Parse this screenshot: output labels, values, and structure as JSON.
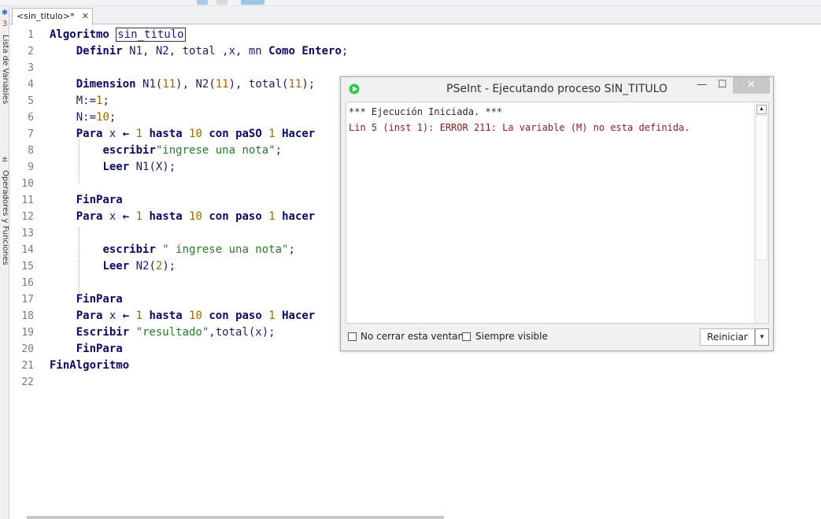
{
  "tab": {
    "label": "<sin_titulo>*",
    "close": "✕"
  },
  "side_panel": {
    "label_vars": "Lista de Variables",
    "label_ops": "Operadores y Funciones"
  },
  "editor": {
    "line_numbers": [
      "1",
      "2",
      "3",
      "4",
      "5",
      "6",
      "7",
      "8",
      "9",
      "10",
      "11",
      "12",
      "13",
      "14",
      "15",
      "16",
      "17",
      "18",
      "19",
      "20",
      "21",
      "22"
    ],
    "lines": [
      [
        {
          "t": "Algoritmo ",
          "c": "kw"
        },
        {
          "t": "sin_titulo",
          "c": "name"
        }
      ],
      [
        {
          "t": "    "
        },
        {
          "t": "Definir ",
          "c": "kw"
        },
        {
          "t": "N1, N2, total ,x, mn "
        },
        {
          "t": "Como Entero",
          "c": "kw"
        },
        {
          "t": ";"
        }
      ],
      [],
      [
        {
          "t": "    "
        },
        {
          "t": "Dimension ",
          "c": "kw"
        },
        {
          "t": "N1("
        },
        {
          "t": "11",
          "c": "num"
        },
        {
          "t": "), N2("
        },
        {
          "t": "11",
          "c": "num"
        },
        {
          "t": "), total("
        },
        {
          "t": "11",
          "c": "num"
        },
        {
          "t": ");"
        }
      ],
      [
        {
          "t": "    M:="
        },
        {
          "t": "1",
          "c": "num"
        },
        {
          "t": ";"
        }
      ],
      [
        {
          "t": "    N:="
        },
        {
          "t": "10",
          "c": "num"
        },
        {
          "t": ";"
        }
      ],
      [
        {
          "t": "    "
        },
        {
          "t": "Para ",
          "c": "kw"
        },
        {
          "t": "x "
        },
        {
          "t": "←",
          "c": "kw"
        },
        {
          "t": " "
        },
        {
          "t": "1",
          "c": "num"
        },
        {
          "t": " "
        },
        {
          "t": "hasta ",
          "c": "kw"
        },
        {
          "t": "10",
          "c": "num"
        },
        {
          "t": " "
        },
        {
          "t": "con paSO ",
          "c": "kw"
        },
        {
          "t": "1",
          "c": "num"
        },
        {
          "t": " "
        },
        {
          "t": "Hacer",
          "c": "kw"
        }
      ],
      [
        {
          "t": "        "
        },
        {
          "t": "escribir",
          "c": "kw"
        },
        {
          "t": "\"ingrese una nota\"",
          "c": "str"
        },
        {
          "t": ";"
        }
      ],
      [
        {
          "t": "        "
        },
        {
          "t": "Leer ",
          "c": "kw"
        },
        {
          "t": "N1(X);"
        }
      ],
      [],
      [
        {
          "t": "    "
        },
        {
          "t": "FinPara",
          "c": "kw"
        }
      ],
      [
        {
          "t": "    "
        },
        {
          "t": "Para ",
          "c": "kw"
        },
        {
          "t": "x "
        },
        {
          "t": "←",
          "c": "kw"
        },
        {
          "t": " "
        },
        {
          "t": "1",
          "c": "num"
        },
        {
          "t": " "
        },
        {
          "t": "hasta ",
          "c": "kw"
        },
        {
          "t": "10",
          "c": "num"
        },
        {
          "t": " "
        },
        {
          "t": "con paso ",
          "c": "kw"
        },
        {
          "t": "1",
          "c": "num"
        },
        {
          "t": " "
        },
        {
          "t": "hacer",
          "c": "kw"
        }
      ],
      [],
      [
        {
          "t": "        "
        },
        {
          "t": "escribir ",
          "c": "kw"
        },
        {
          "t": "\" ingrese una nota\"",
          "c": "str"
        },
        {
          "t": ";"
        }
      ],
      [
        {
          "t": "        "
        },
        {
          "t": "Leer ",
          "c": "kw"
        },
        {
          "t": "N2("
        },
        {
          "t": "2",
          "c": "num"
        },
        {
          "t": ");"
        }
      ],
      [],
      [
        {
          "t": "    "
        },
        {
          "t": "FinPara",
          "c": "kw"
        }
      ],
      [
        {
          "t": "    "
        },
        {
          "t": "Para ",
          "c": "kw"
        },
        {
          "t": "x "
        },
        {
          "t": "←",
          "c": "kw"
        },
        {
          "t": " "
        },
        {
          "t": "1",
          "c": "num"
        },
        {
          "t": " "
        },
        {
          "t": "hasta ",
          "c": "kw"
        },
        {
          "t": "10",
          "c": "num"
        },
        {
          "t": " "
        },
        {
          "t": "con paso ",
          "c": "kw"
        },
        {
          "t": "1",
          "c": "num"
        },
        {
          "t": " "
        },
        {
          "t": "Hacer",
          "c": "kw"
        }
      ],
      [
        {
          "t": "    "
        },
        {
          "t": "Escribir ",
          "c": "kw"
        },
        {
          "t": "\"resultado\"",
          "c": "str"
        },
        {
          "t": ",total(x);"
        }
      ],
      [
        {
          "t": "    "
        },
        {
          "t": "FinPara",
          "c": "kw"
        }
      ],
      [
        {
          "t": "FinAlgoritmo",
          "c": "kw"
        }
      ],
      []
    ]
  },
  "run_window": {
    "title": "PSeInt - Ejecutando proceso SIN_TITULO",
    "minimize": "—",
    "maximize": "☐",
    "close": "✕",
    "output_info": "*** Ejecución Iniciada. ***",
    "output_error": "Lin 5 (inst 1): ERROR 211: La variable (M) no esta definida.",
    "check_no_close": "No cerrar esta ventana",
    "check_always_visible": "Siempre visible",
    "reset_button": "Reiniciar"
  },
  "colors": {
    "keyword": "#0a0a64",
    "number": "#9a6a00",
    "string": "#2b7a2b",
    "error": "#8b1a1a",
    "app_icon": "#2ecc40"
  }
}
